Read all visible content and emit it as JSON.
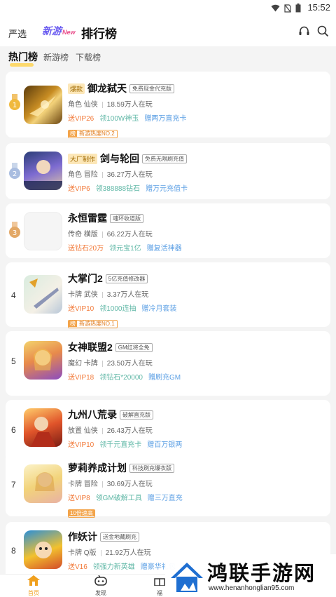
{
  "statusbar": {
    "time": "15:52"
  },
  "header": {
    "tab_yanxuan": "严选",
    "tab_xinyou": "新游",
    "tab_xinyou_badge": "New",
    "tab_rank": "排行榜"
  },
  "subtabs": [
    {
      "label": "热门榜",
      "active": true
    },
    {
      "label": "新游榜",
      "active": false
    },
    {
      "label": "下载榜",
      "active": false
    }
  ],
  "games": [
    {
      "rank": "1",
      "tag": "爆款",
      "name": "御龙弑天",
      "badge": "免费现金代充版",
      "meta": [
        "角色",
        "仙侠"
      ],
      "players": "18.59万人在玩",
      "gifts": [
        "送VIP26",
        "领100W神玉",
        "赠两万直充卡"
      ],
      "rank_chip": "新游热度NO.2"
    },
    {
      "rank": "2",
      "tag": "大厂制作",
      "name": "剑与轮回",
      "badge": "免费无限刷充值",
      "meta": [
        "角色",
        "冒险"
      ],
      "players": "36.27万人在玩",
      "gifts": [
        "送VIP6",
        "领388888钻石",
        "赠万元充值卡"
      ],
      "rank_chip": ""
    },
    {
      "rank": "3",
      "tag": "",
      "name": "永恒雷霆",
      "badge": "魂环收道版",
      "meta": [
        "传奇",
        "横版"
      ],
      "players": "66.22万人在玩",
      "gifts": [
        "送钻石20万",
        "领元宝1亿",
        "赠复活神器"
      ],
      "rank_chip": ""
    },
    {
      "rank": "4",
      "tag": "",
      "name": "大掌门2",
      "badge": "5亿充值修改器",
      "meta": [
        "卡牌",
        "武侠"
      ],
      "players": "3.37万人在玩",
      "gifts": [
        "送VIP10",
        "领1000连抽",
        "赠冷月套装"
      ],
      "rank_chip": "新游热度NO.1"
    },
    {
      "rank": "5",
      "tag": "",
      "name": "女神联盟2",
      "badge": "GM红将全免",
      "meta": [
        "魔幻",
        "卡牌"
      ],
      "players": "23.50万人在玩",
      "gifts": [
        "送VIP18",
        "领钻石*20000",
        "赠刷充GM"
      ],
      "rank_chip": ""
    },
    {
      "rank": "6",
      "tag": "",
      "name": "九州八荒录",
      "badge": "破解直充版",
      "meta": [
        "放置",
        "仙侠"
      ],
      "players": "26.43万人在玩",
      "gifts": [
        "送VIP10",
        "领千元直充卡",
        "赠百万银两"
      ],
      "rank_chip": ""
    },
    {
      "rank": "7",
      "tag": "",
      "name": "萝莉养成计划",
      "badge": "科技刷充爆衣版",
      "meta": [
        "卡牌",
        "冒险"
      ],
      "players": "30.69万人在玩",
      "gifts": [
        "送VIP8",
        "领GM破解工具",
        "赠三万直充"
      ],
      "rank_chip": "10倍速高"
    },
    {
      "rank": "8",
      "tag": "",
      "name": "作妖计",
      "badge": "送金地藏刷充",
      "meta": [
        "卡牌",
        "Q版"
      ],
      "players": "21.92万人在玩",
      "gifts": [
        "送V16",
        "领强力新英雄",
        "赠豪华礼包"
      ],
      "rank_chip": ""
    }
  ],
  "bottomnav": [
    {
      "label": "首页",
      "active": true
    },
    {
      "label": "发现",
      "active": false
    },
    {
      "label": "福",
      "active": false
    }
  ],
  "watermark": {
    "title": "鸿联手游网",
    "url": "www.henanhonglian95.com"
  },
  "colors": {
    "accent": "#f0a01e",
    "gift_orange": "#f27a3a",
    "gift_green": "#61b8a7",
    "gift_blue": "#5b9fe4"
  }
}
